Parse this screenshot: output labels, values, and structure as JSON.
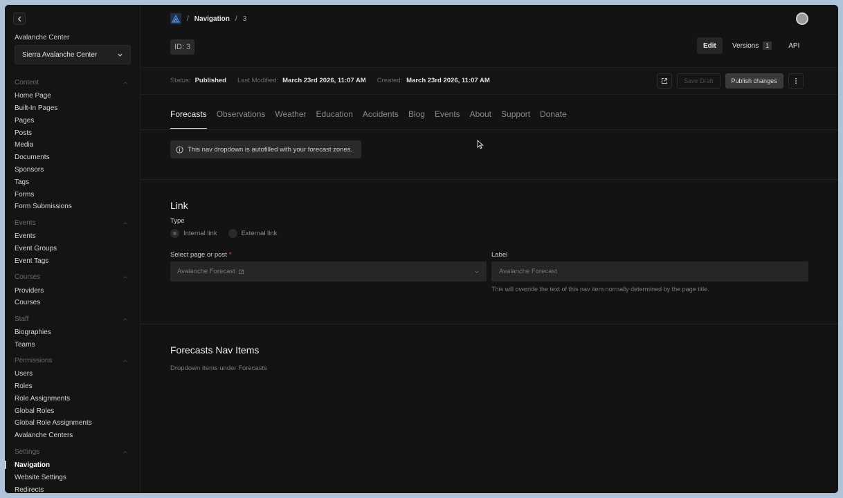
{
  "sidebar": {
    "center_label": "Avalanche Center",
    "center_select_value": "Sierra Avalanche Center",
    "groups": {
      "content": {
        "title": "Content",
        "items": [
          "Home Page",
          "Built-In Pages",
          "Pages",
          "Posts",
          "Media",
          "Documents",
          "Sponsors",
          "Tags",
          "Forms",
          "Form Submissions"
        ]
      },
      "events": {
        "title": "Events",
        "items": [
          "Events",
          "Event Groups",
          "Event Tags"
        ]
      },
      "courses": {
        "title": "Courses",
        "items": [
          "Providers",
          "Courses"
        ]
      },
      "staff": {
        "title": "Staff",
        "items": [
          "Biographies",
          "Teams"
        ]
      },
      "permissions": {
        "title": "Permissions",
        "items": [
          "Users",
          "Roles",
          "Role Assignments",
          "Global Roles",
          "Global Role Assignments",
          "Avalanche Centers"
        ]
      },
      "settings": {
        "title": "Settings",
        "items": [
          "Navigation",
          "Website Settings",
          "Redirects"
        ]
      }
    }
  },
  "header": {
    "crumb_nav": "Navigation",
    "crumb_current": "3",
    "id_chip": "ID: 3",
    "edit_label": "Edit",
    "versions_label": "Versions",
    "versions_count": "1",
    "api_label": "API"
  },
  "status": {
    "status_label": "Status:",
    "status_value": "Published",
    "modified_label": "Last Modified:",
    "modified_value": "March 23rd 2026, 11:07 AM",
    "created_label": "Created:",
    "created_value": "March 23rd 2026, 11:07 AM",
    "save_draft_label": "Save Draft",
    "publish_label": "Publish changes"
  },
  "tabs": [
    "Forecasts",
    "Observations",
    "Weather",
    "Education",
    "Accidents",
    "Blog",
    "Events",
    "About",
    "Support",
    "Donate"
  ],
  "info_banner": "This nav dropdown is autofilled with your forecast zones.",
  "link_section": {
    "title": "Link",
    "type_label": "Type",
    "radio_internal": "Internal link",
    "radio_external": "External link",
    "select_label": "Select page or post",
    "required_mark": "*",
    "select_value": "Avalanche Forecast",
    "label_label": "Label",
    "label_placeholder": "Avalanche Forecast",
    "label_help": "This will override the text of this nav item normally determined by the page title."
  },
  "nav_items_section": {
    "title": "Forecasts Nav Items",
    "subtitle": "Dropdown items under Forecasts"
  }
}
